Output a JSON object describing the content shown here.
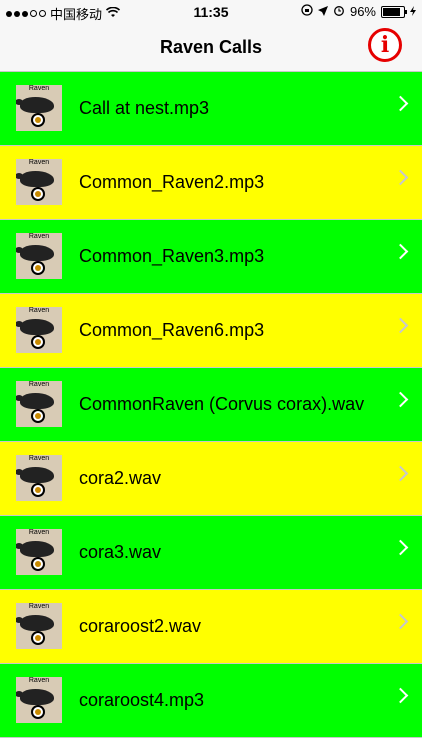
{
  "status_bar": {
    "carrier": "中国移动",
    "time": "11:35",
    "battery": "96%",
    "battery_level": 0.96
  },
  "nav": {
    "title": "Raven Calls",
    "info_icon": "info-icon",
    "info_color": "#e60000"
  },
  "list": {
    "thumbnail_label": "Raven",
    "row_colors": [
      "#00ff00",
      "#ffff00"
    ],
    "items": [
      {
        "label": "Call at nest.mp3"
      },
      {
        "label": "Common_Raven2.mp3"
      },
      {
        "label": "Common_Raven3.mp3"
      },
      {
        "label": "Common_Raven6.mp3"
      },
      {
        "label": "CommonRaven (Corvus corax).wav"
      },
      {
        "label": "cora2.wav"
      },
      {
        "label": "cora3.wav"
      },
      {
        "label": "coraroost2.wav"
      },
      {
        "label": "coraroost4.mp3"
      }
    ]
  }
}
